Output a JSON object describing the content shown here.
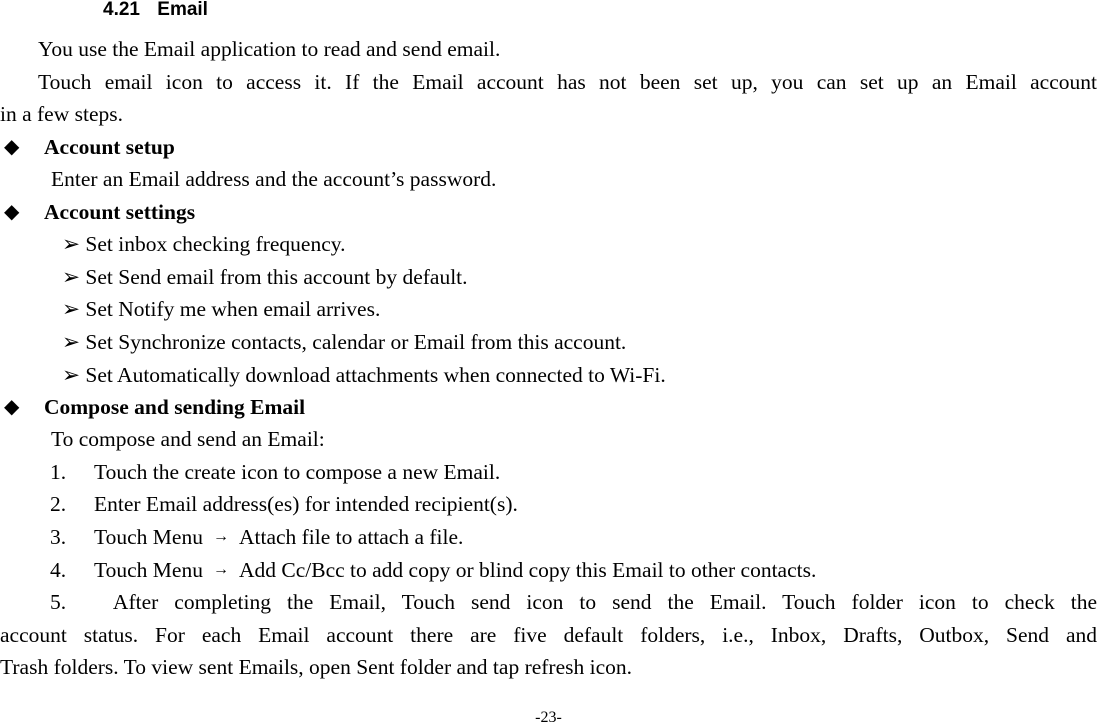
{
  "section": {
    "number": "4.21",
    "title": "Email"
  },
  "intro": [
    "You use the Email application to read and send email.",
    "Touch email icon to access it. If the Email account has not been set up, you can set up an Email account",
    "in a few steps."
  ],
  "account_setup": {
    "heading": "Account setup",
    "text": "Enter an Email address and the account’s password."
  },
  "account_settings": {
    "heading": "Account settings",
    "items": [
      "Set inbox checking frequency.",
      "Set Send email from this account by default.",
      "Set Notify me when email arrives.",
      "Set Synchronize contacts, calendar or Email from this account.",
      "Set Automatically download attachments when connected to Wi-Fi."
    ]
  },
  "compose": {
    "heading": "Compose and sending Email",
    "intro": "To compose and send an Email:",
    "steps": [
      {
        "num": "1.",
        "text": "Touch the create icon to compose a new Email."
      },
      {
        "num": "2.",
        "text": "Enter Email address(es) for intended recipient(s)."
      },
      {
        "num": "3.",
        "prefix": "Touch Menu",
        "arrow": "→",
        "text": "Attach file to attach a file."
      },
      {
        "num": "4.",
        "prefix": "Touch Menu",
        "arrow": "→",
        "text": "Add Cc/Bcc to add copy or blind copy this Email to other contacts."
      },
      {
        "num": "5.",
        "text": "After completing the Email, Touch send icon to send the Email. Touch folder icon to check the"
      }
    ],
    "continuation": [
      "account status. For each Email account there are five default folders, i.e., Inbox, Drafts, Outbox, Send and",
      "Trash folders. To view sent Emails, open Sent folder and tap refresh icon."
    ]
  },
  "bullet_glyph": "◆",
  "arrow_glyph": "➢",
  "page_number": "-23-"
}
